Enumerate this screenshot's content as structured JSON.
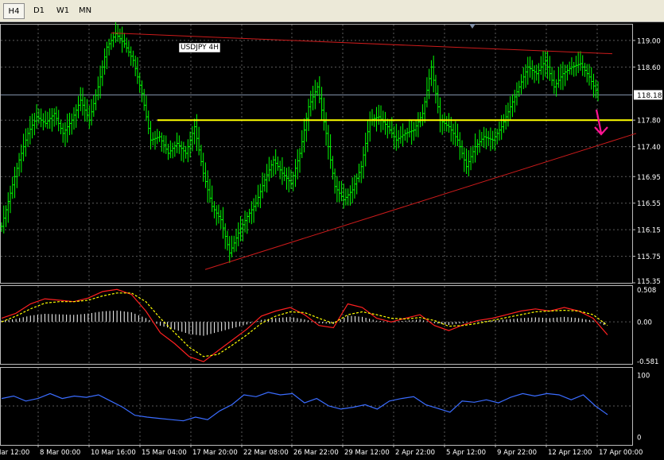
{
  "toolbar": {
    "timeframes": [
      "H4",
      "D1",
      "W1",
      "MN"
    ],
    "active": "H4"
  },
  "colors": {
    "background": "#000000",
    "grid": "#5a5a5a",
    "candle": "#00ff00",
    "trendline": "#cc1b1b",
    "support": "#ffff00",
    "arrow": "#ff1493",
    "macd_main": "#ff2020",
    "macd_signal": "#ffff00",
    "histogram": "#ffffff",
    "indicator2": "#3a6cff"
  },
  "chart_data": [
    {
      "type": "line",
      "title": "USDJPY 4H",
      "symbol": "USDJPY",
      "timeframe": "4H",
      "ylim": [
        115.35,
        119.25
      ],
      "y_ticks": [
        "119.00",
        "118.60",
        "118.18",
        "117.80",
        "117.40",
        "116.95",
        "116.55",
        "116.15",
        "115.75",
        "115.35"
      ],
      "current_price": "118.18",
      "x_ticks": [
        "2 Mar 12:00",
        "8 Mar 00:00",
        "10 Mar 16:00",
        "15 Mar 04:00",
        "17 Mar 20:00",
        "22 Mar 08:00",
        "26 Mar 22:00",
        "29 Mar 12:00",
        "2 Apr 22:00",
        "5 Apr 12:00",
        "9 Apr 22:00",
        "12 Apr 12:00",
        "17 Apr 00:00"
      ],
      "series": [
        {
          "values": [
            116.2,
            116.7,
            117.2,
            117.6,
            117.85,
            117.75,
            117.9,
            117.6,
            117.8,
            118.1,
            117.8,
            118.3,
            118.9,
            119.1,
            118.95,
            118.7,
            118.2,
            117.5,
            117.55,
            117.3,
            117.45,
            117.3,
            117.7,
            117.0,
            116.5,
            116.3,
            115.8,
            116.1,
            116.35,
            116.55,
            116.9,
            117.2,
            117.0,
            116.85,
            117.3,
            118.0,
            118.3,
            117.6,
            116.8,
            116.6,
            116.75,
            117.1,
            117.8,
            117.85,
            117.7,
            117.5,
            117.6,
            117.65,
            117.9,
            118.6,
            117.8,
            117.7,
            117.5,
            117.1,
            117.4,
            117.55,
            117.5,
            117.7,
            118.0,
            118.3,
            118.6,
            118.5,
            118.7,
            118.3,
            118.5,
            118.6,
            118.65,
            118.45,
            118.18
          ]
        }
      ],
      "annotations": {
        "resistance_line": {
          "x": [
            "10 Mar 16:00",
            "17 Apr 00:00"
          ],
          "y": [
            119.1,
            118.8
          ]
        },
        "support_trendline": {
          "x": [
            "17 Mar 20:00",
            "17 Apr 00:00"
          ],
          "y": [
            115.55,
            117.6
          ]
        },
        "horizontal_level": 117.8,
        "down_arrow": true
      }
    },
    {
      "type": "line",
      "title": "",
      "ylim": [
        -0.581,
        0.508
      ],
      "y_ticks": [
        "0.508",
        "0.00",
        "-0.581"
      ],
      "series": [
        {
          "values": [
            0.05,
            0.12,
            0.25,
            0.32,
            0.3,
            0.28,
            0.33,
            0.42,
            0.45,
            0.38,
            0.15,
            -0.15,
            -0.3,
            -0.48,
            -0.55,
            -0.4,
            -0.25,
            -0.1,
            0.08,
            0.15,
            0.2,
            0.1,
            -0.05,
            -0.08,
            0.25,
            0.2,
            0.05,
            0.0,
            0.05,
            0.1,
            -0.05,
            -0.12,
            -0.04,
            0.02,
            0.05,
            0.1,
            0.15,
            0.18,
            0.15,
            0.2,
            0.15,
            0.05,
            -0.18
          ]
        },
        {
          "values": [
            0.0,
            0.08,
            0.18,
            0.26,
            0.28,
            0.28,
            0.3,
            0.36,
            0.4,
            0.4,
            0.28,
            0.05,
            -0.15,
            -0.35,
            -0.48,
            -0.45,
            -0.32,
            -0.18,
            -0.02,
            0.08,
            0.14,
            0.13,
            0.05,
            -0.02,
            0.1,
            0.14,
            0.1,
            0.05,
            0.04,
            0.06,
            0.02,
            -0.06,
            -0.05,
            -0.02,
            0.02,
            0.06,
            0.1,
            0.14,
            0.15,
            0.16,
            0.15,
            0.1,
            -0.05
          ]
        }
      ]
    },
    {
      "type": "line",
      "title": "",
      "ylim": [
        0,
        100
      ],
      "y_ticks": [
        "100",
        "0"
      ],
      "series": [
        {
          "values": [
            62,
            66,
            58,
            62,
            70,
            62,
            66,
            64,
            68,
            58,
            48,
            35,
            32,
            30,
            28,
            26,
            32,
            28,
            42,
            52,
            68,
            65,
            72,
            68,
            70,
            55,
            62,
            50,
            45,
            48,
            52,
            45,
            58,
            62,
            65,
            52,
            46,
            40,
            58,
            56,
            60,
            55,
            64,
            70,
            66,
            70,
            68,
            60,
            68,
            50,
            36
          ]
        }
      ]
    }
  ]
}
